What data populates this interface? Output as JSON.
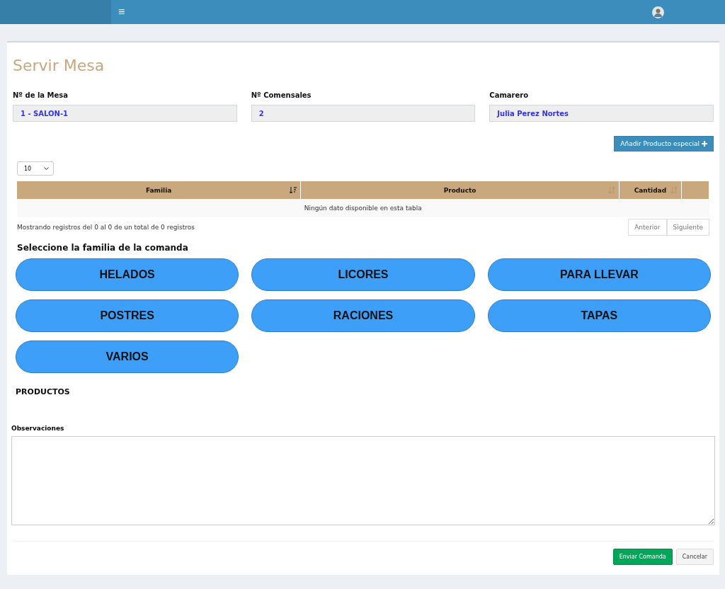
{
  "header": {
    "menu_glyph": "≡"
  },
  "page": {
    "title": "Servir Mesa"
  },
  "fields": [
    {
      "label": "Nº de la Mesa",
      "value": "1 - SALON-1"
    },
    {
      "label": "Nº Comensales",
      "value": "2"
    },
    {
      "label": "Camarero",
      "value": "Julia Perez Nortes"
    }
  ],
  "special_button": {
    "label": "Añadir Producto especial"
  },
  "page_size": "10",
  "table": {
    "columns": [
      {
        "label": "Familia",
        "sortable": true,
        "sorted": true
      },
      {
        "label": "Producto",
        "sortable": true,
        "sorted": false
      },
      {
        "label": "Cantidad",
        "sortable": true,
        "sorted": false
      }
    ],
    "empty_message": "Ningún dato disponible en esta tabla",
    "info": "Mostrando registros del 0 al 0 de un total de 0 registros",
    "pagination": [
      {
        "label": "Anterior",
        "disabled": true
      },
      {
        "label": "Siguiente",
        "disabled": true
      }
    ]
  },
  "families_title": "Seleccione la familia de la comanda",
  "families": [
    "HELADOS",
    "LICORES",
    "PARA LLEVAR",
    "POSTRES",
    "RACIONES",
    "TAPAS",
    "VARIOS"
  ],
  "products_title": "PRODUCTOS",
  "observations": {
    "label": "Observaciones"
  },
  "actions": [
    {
      "kind": "primary",
      "label": "Enviar Comanda"
    },
    {
      "kind": "default",
      "label": "Cancelar"
    }
  ]
}
